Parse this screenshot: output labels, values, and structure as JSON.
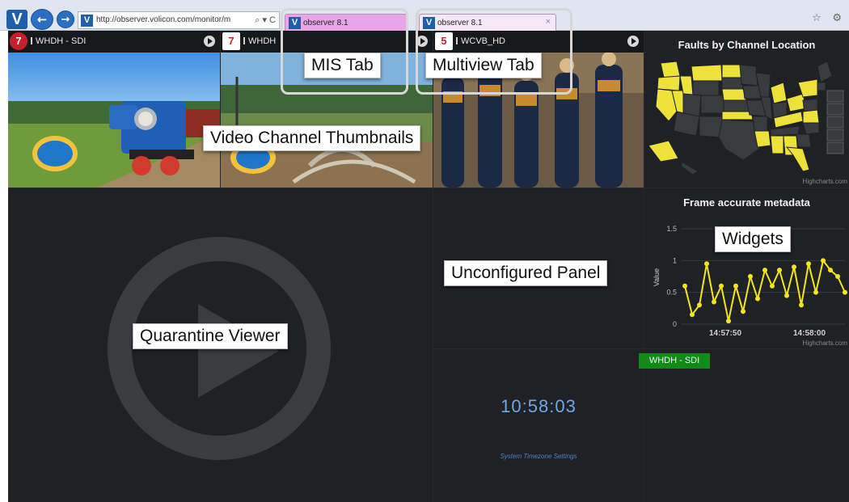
{
  "browser": {
    "logo": "V",
    "back_icon": "←",
    "forward_icon": "→",
    "favicon": "V",
    "url": "http://observer.volicon.com/monitor/m",
    "address_icons": "⌕ ▾ C",
    "tabs": [
      {
        "label": "observer 8.1",
        "active": true
      },
      {
        "label": "observer 8.1",
        "close": "×"
      }
    ],
    "right_icons": "☆ ⚙"
  },
  "channels": [
    {
      "logo": "7",
      "name": "WHDH - SDI"
    },
    {
      "logo": "7",
      "name": "WHDH"
    },
    {
      "logo": "5",
      "name": "WCVB_HD"
    }
  ],
  "map_panel": {
    "title": "Faults by Channel Location",
    "credit": "Highcharts.com",
    "states": [
      "WA",
      "MT",
      "ND",
      "MN",
      "ME",
      "OR",
      "ID",
      "SD",
      "WI",
      "NY",
      "NH",
      "WY",
      "MI",
      "RI",
      "NV",
      "UT",
      "NE",
      "IA",
      "CT",
      "CA",
      "CO",
      "KS",
      "MO",
      "IL",
      "OH",
      "NJ",
      "AZ",
      "NM",
      "OK",
      "AR",
      "KY",
      "VA",
      "DE",
      "TX",
      "LA",
      "AL",
      "GA",
      "MD",
      "FL",
      "AK",
      "HI"
    ]
  },
  "chart_data": {
    "type": "line",
    "title": "Frame accurate metadata",
    "ylabel": "Value",
    "ylim": [
      0,
      1.5
    ],
    "yticks": [
      "0",
      "0.5",
      "1",
      "1.5"
    ],
    "xticks": [
      "14:57:50",
      "14:58:00"
    ],
    "credit": "Highcharts.com",
    "series": [
      {
        "color": "#f2e51b",
        "values": [
          0.6,
          0.15,
          0.3,
          0.95,
          0.35,
          0.6,
          0.05,
          0.6,
          0.2,
          0.75,
          0.4,
          0.85,
          0.6,
          0.85,
          0.45,
          0.9,
          0.3,
          0.95,
          0.5,
          1.0,
          0.85,
          0.75,
          0.5
        ]
      }
    ]
  },
  "clock": {
    "time": "10:58:03",
    "timezone_link": "System Timezone Settings"
  },
  "badge": {
    "label": "WHDH - SDI",
    "color": "#118a17"
  },
  "callouts": {
    "mis_tab": "MIS Tab",
    "multiview_tab": "Multiview Tab",
    "thumbnails": "Video Channel Thumbnails",
    "unconfigured": "Unconfigured Panel",
    "quarantine": "Quarantine Viewer",
    "widgets": "Widgets"
  }
}
